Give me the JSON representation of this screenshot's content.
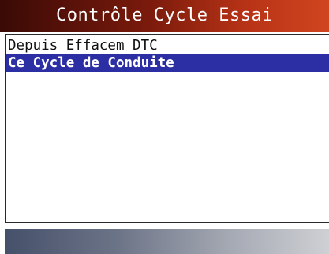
{
  "header": {
    "title": "Contrôle Cycle Essai"
  },
  "menu": {
    "items": [
      {
        "label": "Depuis Effacem DTC",
        "selected": false
      },
      {
        "label": "Ce Cycle de Conduite",
        "selected": true
      }
    ]
  },
  "colors": {
    "title_bar_dark": "#3a0a06",
    "title_bar_light": "#d0451f",
    "selection": "#2b2fa3",
    "footer_dark": "#45506a",
    "footer_light": "#cfd0d4"
  }
}
